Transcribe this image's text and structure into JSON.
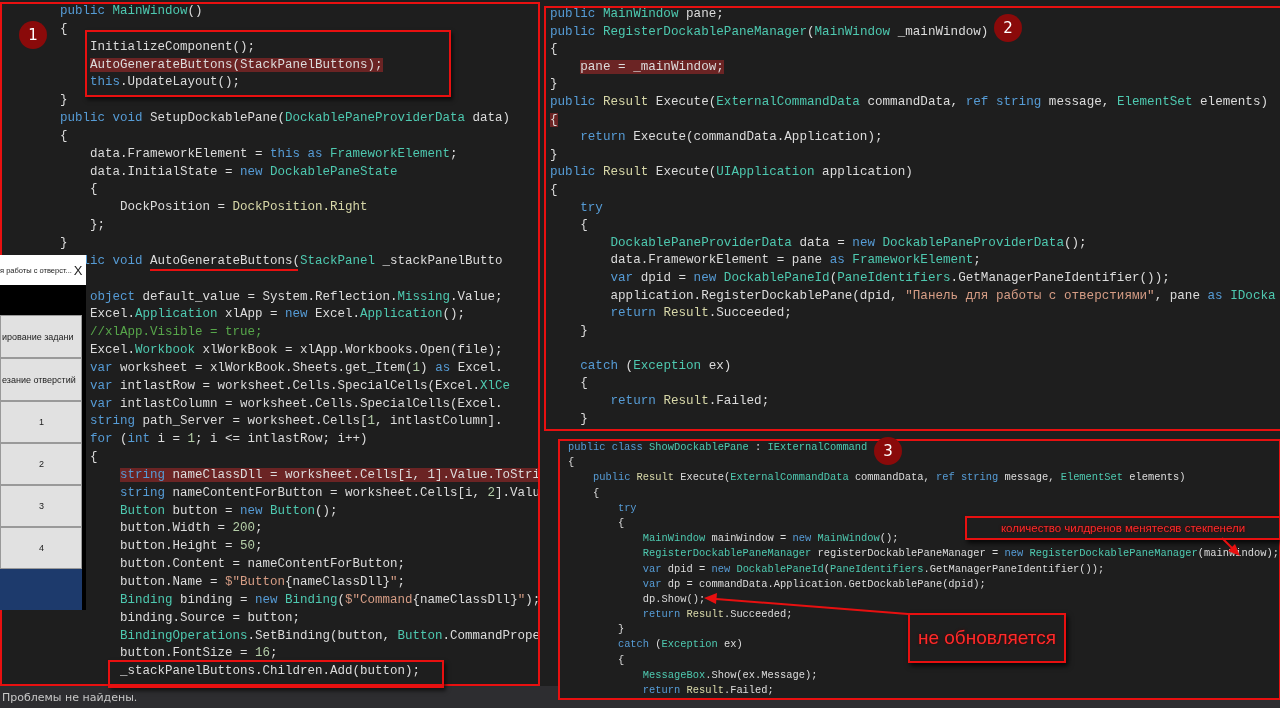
{
  "editor_left": {
    "badge": "1",
    "blocks": [
      [
        {
          "hl": false,
          "tokens": [
            {
              "text": "public ",
              "kind": "keyword"
            },
            {
              "text": "MainWindow",
              "kind": "type"
            },
            {
              "text": "()",
              "kind": "plain"
            }
          ]
        },
        {
          "hl": false,
          "tokens": [
            {
              "text": "{",
              "kind": "plain"
            }
          ]
        },
        {
          "hl": false,
          "tokens": [
            {
              "text": "    InitializeComponent();",
              "kind": "plain"
            }
          ]
        },
        {
          "hl": true,
          "tokens": [
            {
              "text": "    AutoGenerateButtons(StackPanelButtons);",
              "kind": "plain"
            }
          ]
        },
        {
          "hl": false,
          "tokens": [
            {
              "text": "    this",
              "kind": "keyword"
            },
            {
              "text": ".UpdateLayout();",
              "kind": "plain"
            }
          ]
        },
        {
          "hl": false,
          "tokens": [
            {
              "text": "}",
              "kind": "plain"
            }
          ]
        },
        {
          "hl": false,
          "tokens": [
            {
              "text": "public void ",
              "kind": "keyword"
            },
            {
              "text": "SetupDockablePane(",
              "kind": "plain"
            },
            {
              "text": "DockablePaneProviderData",
              "kind": "type"
            },
            {
              "text": " data)",
              "kind": "plain"
            }
          ]
        },
        {
          "hl": false,
          "tokens": [
            {
              "text": "{",
              "kind": "plain"
            }
          ]
        },
        {
          "hl": false,
          "tokens": [
            {
              "text": "    data.FrameworkElement = ",
              "kind": "plain"
            },
            {
              "text": "this as ",
              "kind": "keyword"
            },
            {
              "text": "FrameworkElement",
              "kind": "type"
            },
            {
              "text": ";",
              "kind": "plain"
            }
          ]
        },
        {
          "hl": false,
          "tokens": [
            {
              "text": "    data.InitialState = ",
              "kind": "plain"
            },
            {
              "text": "new ",
              "kind": "keyword"
            },
            {
              "text": "DockablePaneState",
              "kind": "type"
            }
          ]
        },
        {
          "hl": false,
          "tokens": [
            {
              "text": "    {",
              "kind": "plain"
            }
          ]
        },
        {
          "hl": false,
          "tokens": [
            {
              "text": "        DockPosition = ",
              "kind": "plain"
            },
            {
              "text": "DockPosition.Right",
              "kind": "value"
            }
          ]
        },
        {
          "hl": false,
          "tokens": [
            {
              "text": "    };",
              "kind": "plain"
            }
          ]
        },
        {
          "hl": false,
          "tokens": [
            {
              "text": "}",
              "kind": "plain"
            }
          ]
        },
        {
          "hl": false,
          "tokens": [
            {
              "text": "   lic void ",
              "kind": "keyword"
            },
            {
              "text": "AutoGenerateButtons(",
              "kind": "plain"
            },
            {
              "text": "StackPanel",
              "kind": "type"
            },
            {
              "text": " _stackPanelButto",
              "kind": "plain"
            }
          ]
        }
      ],
      [
        {
          "hl": false,
          "tokens": [
            {
              "text": "    object ",
              "kind": "keyword"
            },
            {
              "text": "default_value = System.Reflection.",
              "kind": "plain"
            },
            {
              "text": "Missing",
              "kind": "type"
            },
            {
              "text": ".Value;",
              "kind": "plain"
            }
          ]
        },
        {
          "hl": false,
          "tokens": [
            {
              "text": "    Excel.",
              "kind": "plain"
            },
            {
              "text": "Application",
              "kind": "type"
            },
            {
              "text": " xlApp = ",
              "kind": "plain"
            },
            {
              "text": "new ",
              "kind": "keyword"
            },
            {
              "text": "Excel.",
              "kind": "plain"
            },
            {
              "text": "Application",
              "kind": "type"
            },
            {
              "text": "();",
              "kind": "plain"
            }
          ]
        },
        {
          "hl": false,
          "tokens": [
            {
              "text": "    //xlApp.Visible = true;",
              "kind": "comment"
            }
          ]
        },
        {
          "hl": false,
          "tokens": [
            {
              "text": "    Excel.",
              "kind": "plain"
            },
            {
              "text": "Workbook",
              "kind": "type"
            },
            {
              "text": " xlWorkBook = xlApp.Workbooks.Open(file);",
              "kind": "plain"
            }
          ]
        },
        {
          "hl": false,
          "tokens": [
            {
              "text": "    var ",
              "kind": "keyword"
            },
            {
              "text": "worksheet = xlWorkBook.Sheets.get_Item(",
              "kind": "plain"
            },
            {
              "text": "1",
              "kind": "number"
            },
            {
              "text": ") ",
              "kind": "plain"
            },
            {
              "text": "as ",
              "kind": "keyword"
            },
            {
              "text": "Excel.",
              "kind": "plain"
            }
          ]
        },
        {
          "hl": false,
          "tokens": [
            {
              "text": "    var ",
              "kind": "keyword"
            },
            {
              "text": "intlastRow = worksheet.Cells.SpecialCells(Excel.",
              "kind": "plain"
            },
            {
              "text": "XlCe",
              "kind": "type"
            }
          ]
        },
        {
          "hl": false,
          "tokens": [
            {
              "text": "    var ",
              "kind": "keyword"
            },
            {
              "text": "intlastColumn = worksheet.Cells.SpecialCells(Excel.",
              "kind": "plain"
            }
          ]
        },
        {
          "hl": false,
          "tokens": [
            {
              "text": "    string ",
              "kind": "keyword"
            },
            {
              "text": "path_Server = worksheet.Cells[",
              "kind": "plain"
            },
            {
              "text": "1",
              "kind": "number"
            },
            {
              "text": ", intlastColumn].",
              "kind": "plain"
            }
          ]
        },
        {
          "hl": false,
          "tokens": [
            {
              "text": "    for ",
              "kind": "keyword"
            },
            {
              "text": "(",
              "kind": "plain"
            },
            {
              "text": "int ",
              "kind": "keyword"
            },
            {
              "text": "i = ",
              "kind": "plain"
            },
            {
              "text": "1",
              "kind": "number"
            },
            {
              "text": "; i <= intlastRow; i++)",
              "kind": "plain"
            }
          ]
        },
        {
          "hl": false,
          "tokens": [
            {
              "text": "    {",
              "kind": "plain"
            }
          ]
        },
        {
          "hl": true,
          "tokens": [
            {
              "text": "        string ",
              "kind": "keyword"
            },
            {
              "text": "nameClassDll = worksheet.Cells[i, 1].Value.ToStri",
              "kind": "plain"
            }
          ]
        },
        {
          "hl": false,
          "tokens": [
            {
              "text": "        string ",
              "kind": "keyword"
            },
            {
              "text": "nameContentForButton = worksheet.Cells[i, ",
              "kind": "plain"
            },
            {
              "text": "2",
              "kind": "number"
            },
            {
              "text": "].Valu",
              "kind": "plain"
            }
          ]
        },
        {
          "hl": false,
          "tokens": [
            {
              "text": "        Button",
              "kind": "type"
            },
            {
              "text": " button = ",
              "kind": "plain"
            },
            {
              "text": "new ",
              "kind": "keyword"
            },
            {
              "text": "Button",
              "kind": "type"
            },
            {
              "text": "();",
              "kind": "plain"
            }
          ]
        },
        {
          "hl": false,
          "tokens": [
            {
              "text": "        button.Width = ",
              "kind": "plain"
            },
            {
              "text": "200",
              "kind": "number"
            },
            {
              "text": ";",
              "kind": "plain"
            }
          ]
        },
        {
          "hl": false,
          "tokens": [
            {
              "text": "        button.Height = ",
              "kind": "plain"
            },
            {
              "text": "50",
              "kind": "number"
            },
            {
              "text": ";",
              "kind": "plain"
            }
          ]
        },
        {
          "hl": false,
          "tokens": [
            {
              "text": "        button.Content = nameContentForButton;",
              "kind": "plain"
            }
          ]
        },
        {
          "hl": false,
          "tokens": [
            {
              "text": "        button.Name = ",
              "kind": "plain"
            },
            {
              "text": "$\"Button",
              "kind": "string"
            },
            {
              "text": "{nameClassDll}",
              "kind": "plain"
            },
            {
              "text": "\"",
              "kind": "string"
            },
            {
              "text": ";",
              "kind": "plain"
            }
          ]
        },
        {
          "hl": false,
          "tokens": [
            {
              "text": "        Binding",
              "kind": "type"
            },
            {
              "text": " binding = ",
              "kind": "plain"
            },
            {
              "text": "new ",
              "kind": "keyword"
            },
            {
              "text": "Binding",
              "kind": "type"
            },
            {
              "text": "(",
              "kind": "plain"
            },
            {
              "text": "$\"Command",
              "kind": "string"
            },
            {
              "text": "{nameClassDll}",
              "kind": "plain"
            },
            {
              "text": "\"",
              "kind": "string"
            },
            {
              "text": ");",
              "kind": "plain"
            }
          ]
        },
        {
          "hl": false,
          "tokens": [
            {
              "text": "        binding.Source = button;",
              "kind": "plain"
            }
          ]
        },
        {
          "hl": false,
          "tokens": [
            {
              "text": "        BindingOperations",
              "kind": "type"
            },
            {
              "text": ".SetBinding(button, ",
              "kind": "plain"
            },
            {
              "text": "Button",
              "kind": "type"
            },
            {
              "text": ".CommandPrope",
              "kind": "plain"
            }
          ]
        },
        {
          "hl": false,
          "tokens": [
            {
              "text": "        button.FontSize = ",
              "kind": "plain"
            },
            {
              "text": "16",
              "kind": "number"
            },
            {
              "text": ";",
              "kind": "plain"
            }
          ]
        },
        {
          "hl": false,
          "tokens": [
            {
              "text": "        _stackPanelButtons.Children.Add(button);",
              "kind": "plain"
            }
          ]
        }
      ]
    ]
  },
  "popup_window": {
    "title": "я работы с отверст...",
    "close": "X",
    "buttons": [
      "ирование задани",
      "езание отверстий",
      "1",
      "2",
      "3",
      "4"
    ]
  },
  "editor_right_top": {
    "badge": "2",
    "blocks": [
      [
        {
          "hl": false,
          "tokens": [
            {
              "text": "public ",
              "kind": "keyword"
            },
            {
              "text": "MainWindow",
              "kind": "type"
            },
            {
              "text": " pane;",
              "kind": "plain"
            }
          ]
        },
        {
          "hl": false,
          "tokens": [
            {
              "text": "public ",
              "kind": "keyword"
            },
            {
              "text": "RegisterDockablePaneManager",
              "kind": "type"
            },
            {
              "text": "(",
              "kind": "plain"
            },
            {
              "text": "MainWindow",
              "kind": "type"
            },
            {
              "text": " _mainWindow)",
              "kind": "plain"
            }
          ]
        },
        {
          "hl": false,
          "tokens": [
            {
              "text": "{",
              "kind": "plain"
            }
          ]
        },
        {
          "hl": true,
          "tokens": [
            {
              "text": "    pane = _mainWindow;",
              "kind": "plain"
            }
          ]
        },
        {
          "hl": false,
          "tokens": [
            {
              "text": "}",
              "kind": "plain"
            }
          ]
        },
        {
          "hl": false,
          "tokens": [
            {
              "text": "public ",
              "kind": "keyword"
            },
            {
              "text": "Result",
              "kind": "value"
            },
            {
              "text": " Execute(",
              "kind": "plain"
            },
            {
              "text": "ExternalCommandData",
              "kind": "type"
            },
            {
              "text": " commandData, ",
              "kind": "plain"
            },
            {
              "text": "ref string ",
              "kind": "keyword"
            },
            {
              "text": "message, ",
              "kind": "plain"
            },
            {
              "text": "ElementSet",
              "kind": "type"
            },
            {
              "text": " elements)",
              "kind": "plain"
            }
          ]
        },
        {
          "hl": true,
          "tokens": [
            {
              "text": "{",
              "kind": "plain"
            }
          ]
        },
        {
          "hl": false,
          "tokens": [
            {
              "text": "    return ",
              "kind": "keyword"
            },
            {
              "text": "Execute(commandData.Application);",
              "kind": "plain"
            }
          ]
        },
        {
          "hl": false,
          "tokens": [
            {
              "text": "}",
              "kind": "plain"
            }
          ]
        },
        {
          "hl": false,
          "tokens": [
            {
              "text": "public ",
              "kind": "keyword"
            },
            {
              "text": "Result",
              "kind": "value"
            },
            {
              "text": " Execute(",
              "kind": "plain"
            },
            {
              "text": "UIApplication",
              "kind": "type"
            },
            {
              "text": " application)",
              "kind": "plain"
            }
          ]
        },
        {
          "hl": false,
          "tokens": [
            {
              "text": "{",
              "kind": "plain"
            }
          ]
        },
        {
          "hl": false,
          "tokens": [
            {
              "text": "    try",
              "kind": "keyword"
            }
          ]
        },
        {
          "hl": false,
          "tokens": [
            {
              "text": "    {",
              "kind": "plain"
            }
          ]
        },
        {
          "hl": false,
          "tokens": [
            {
              "text": "        DockablePaneProviderData",
              "kind": "type"
            },
            {
              "text": " data = ",
              "kind": "plain"
            },
            {
              "text": "new ",
              "kind": "keyword"
            },
            {
              "text": "DockablePaneProviderData",
              "kind": "type"
            },
            {
              "text": "();",
              "kind": "plain"
            }
          ]
        },
        {
          "hl": false,
          "tokens": [
            {
              "text": "        data.FrameworkElement = pane ",
              "kind": "plain"
            },
            {
              "text": "as ",
              "kind": "keyword"
            },
            {
              "text": "FrameworkElement",
              "kind": "type"
            },
            {
              "text": ";",
              "kind": "plain"
            }
          ]
        },
        {
          "hl": false,
          "tokens": [
            {
              "text": "        var ",
              "kind": "keyword"
            },
            {
              "text": "dpid = ",
              "kind": "plain"
            },
            {
              "text": "new ",
              "kind": "keyword"
            },
            {
              "text": "DockablePaneId",
              "kind": "type"
            },
            {
              "text": "(",
              "kind": "plain"
            },
            {
              "text": "PaneIdentifiers",
              "kind": "type"
            },
            {
              "text": ".GetManagerPaneIdentifier());",
              "kind": "plain"
            }
          ]
        },
        {
          "hl": false,
          "tokens": [
            {
              "text": "        application.RegisterDockablePane(dpid, ",
              "kind": "plain"
            },
            {
              "text": "\"Панель для работы с отверстиями\"",
              "kind": "string"
            },
            {
              "text": ", pane ",
              "kind": "plain"
            },
            {
              "text": "as ",
              "kind": "keyword"
            },
            {
              "text": "IDocka",
              "kind": "type"
            }
          ]
        },
        {
          "hl": false,
          "tokens": [
            {
              "text": "        return ",
              "kind": "keyword"
            },
            {
              "text": "Result",
              "kind": "value"
            },
            {
              "text": ".Succeeded;",
              "kind": "plain"
            }
          ]
        },
        {
          "hl": false,
          "tokens": [
            {
              "text": "    }",
              "kind": "plain"
            }
          ]
        }
      ],
      [
        {
          "hl": false,
          "tokens": [
            {
              "text": "    catch ",
              "kind": "keyword"
            },
            {
              "text": "(",
              "kind": "plain"
            },
            {
              "text": "Exception",
              "kind": "type"
            },
            {
              "text": " ex)",
              "kind": "plain"
            }
          ]
        },
        {
          "hl": false,
          "tokens": [
            {
              "text": "    {",
              "kind": "plain"
            }
          ]
        },
        {
          "hl": false,
          "tokens": [
            {
              "text": "        return ",
              "kind": "keyword"
            },
            {
              "text": "Result",
              "kind": "value"
            },
            {
              "text": ".Failed;",
              "kind": "plain"
            }
          ]
        },
        {
          "hl": false,
          "tokens": [
            {
              "text": "    }",
              "kind": "plain"
            }
          ]
        }
      ]
    ]
  },
  "editor_right_bottom": {
    "badge": "3",
    "blocks": [
      [
        {
          "hl": false,
          "tokens": [
            {
              "text": "public class ",
              "kind": "keyword"
            },
            {
              "text": "ShowDockablePane",
              "kind": "type"
            },
            {
              "text": " : ",
              "kind": "plain"
            },
            {
              "text": "IExternalCommand",
              "kind": "type"
            }
          ]
        },
        {
          "hl": false,
          "tokens": [
            {
              "text": "{",
              "kind": "plain"
            }
          ]
        },
        {
          "hl": false,
          "tokens": [
            {
              "text": "    public ",
              "kind": "keyword"
            },
            {
              "text": "Result",
              "kind": "value"
            },
            {
              "text": " Execute(",
              "kind": "plain"
            },
            {
              "text": "ExternalCommandData",
              "kind": "type"
            },
            {
              "text": " commandData, ",
              "kind": "plain"
            },
            {
              "text": "ref string ",
              "kind": "keyword"
            },
            {
              "text": "message, ",
              "kind": "plain"
            },
            {
              "text": "ElementSet",
              "kind": "type"
            },
            {
              "text": " elements)",
              "kind": "plain"
            }
          ]
        },
        {
          "hl": false,
          "tokens": [
            {
              "text": "    {",
              "kind": "plain"
            }
          ]
        },
        {
          "hl": false,
          "tokens": [
            {
              "text": "        try",
              "kind": "keyword"
            }
          ]
        },
        {
          "hl": false,
          "tokens": [
            {
              "text": "        {",
              "kind": "plain"
            }
          ]
        },
        {
          "hl": false,
          "tokens": [
            {
              "text": "            MainWindow",
              "kind": "type"
            },
            {
              "text": " mainWindow = ",
              "kind": "plain"
            },
            {
              "text": "new ",
              "kind": "keyword"
            },
            {
              "text": "MainWindow",
              "kind": "type"
            },
            {
              "text": "();",
              "kind": "plain"
            }
          ]
        },
        {
          "hl": false,
          "tokens": [
            {
              "text": "            RegisterDockablePaneManager",
              "kind": "type"
            },
            {
              "text": " registerDockablePaneManager = ",
              "kind": "plain"
            },
            {
              "text": "new ",
              "kind": "keyword"
            },
            {
              "text": "RegisterDockablePaneManager",
              "kind": "type"
            },
            {
              "text": "(mainWindow);",
              "kind": "plain"
            }
          ]
        },
        {
          "hl": false,
          "tokens": [
            {
              "text": "            var ",
              "kind": "keyword"
            },
            {
              "text": "dpid = ",
              "kind": "plain"
            },
            {
              "text": "new ",
              "kind": "keyword"
            },
            {
              "text": "DockablePaneId",
              "kind": "type"
            },
            {
              "text": "(",
              "kind": "plain"
            },
            {
              "text": "PaneIdentifiers",
              "kind": "type"
            },
            {
              "text": ".GetManagerPaneIdentifier());",
              "kind": "plain"
            }
          ]
        },
        {
          "hl": false,
          "tokens": [
            {
              "text": "            var ",
              "kind": "keyword"
            },
            {
              "text": "dp = commandData.Application.GetDockablePane(dpid);",
              "kind": "plain"
            }
          ]
        },
        {
          "hl": false,
          "tokens": [
            {
              "text": "            dp.Show();",
              "kind": "plain"
            }
          ]
        },
        {
          "hl": false,
          "tokens": [
            {
              "text": "            return ",
              "kind": "keyword"
            },
            {
              "text": "Result",
              "kind": "value"
            },
            {
              "text": ".Succeeded;",
              "kind": "plain"
            }
          ]
        },
        {
          "hl": false,
          "tokens": [
            {
              "text": "        }",
              "kind": "plain"
            }
          ]
        },
        {
          "hl": false,
          "tokens": [
            {
              "text": "        catch ",
              "kind": "keyword"
            },
            {
              "text": "(",
              "kind": "plain"
            },
            {
              "text": "Exception",
              "kind": "type"
            },
            {
              "text": " ex)",
              "kind": "plain"
            }
          ]
        },
        {
          "hl": false,
          "tokens": [
            {
              "text": "        {",
              "kind": "plain"
            }
          ]
        },
        {
          "hl": false,
          "tokens": [
            {
              "text": "            MessageBox",
              "kind": "type"
            },
            {
              "text": ".Show(ex.Message);",
              "kind": "plain"
            }
          ]
        },
        {
          "hl": false,
          "tokens": [
            {
              "text": "            return ",
              "kind": "keyword"
            },
            {
              "text": "Result",
              "kind": "value"
            },
            {
              "text": ".Failed;",
              "kind": "plain"
            }
          ]
        }
      ]
    ]
  },
  "callouts": [
    {
      "text": "количество чилдренов менятесяв стекпенели"
    },
    {
      "text": "не обновляется"
    }
  ],
  "status_bar": {
    "text": "Проблемы не найдены."
  }
}
